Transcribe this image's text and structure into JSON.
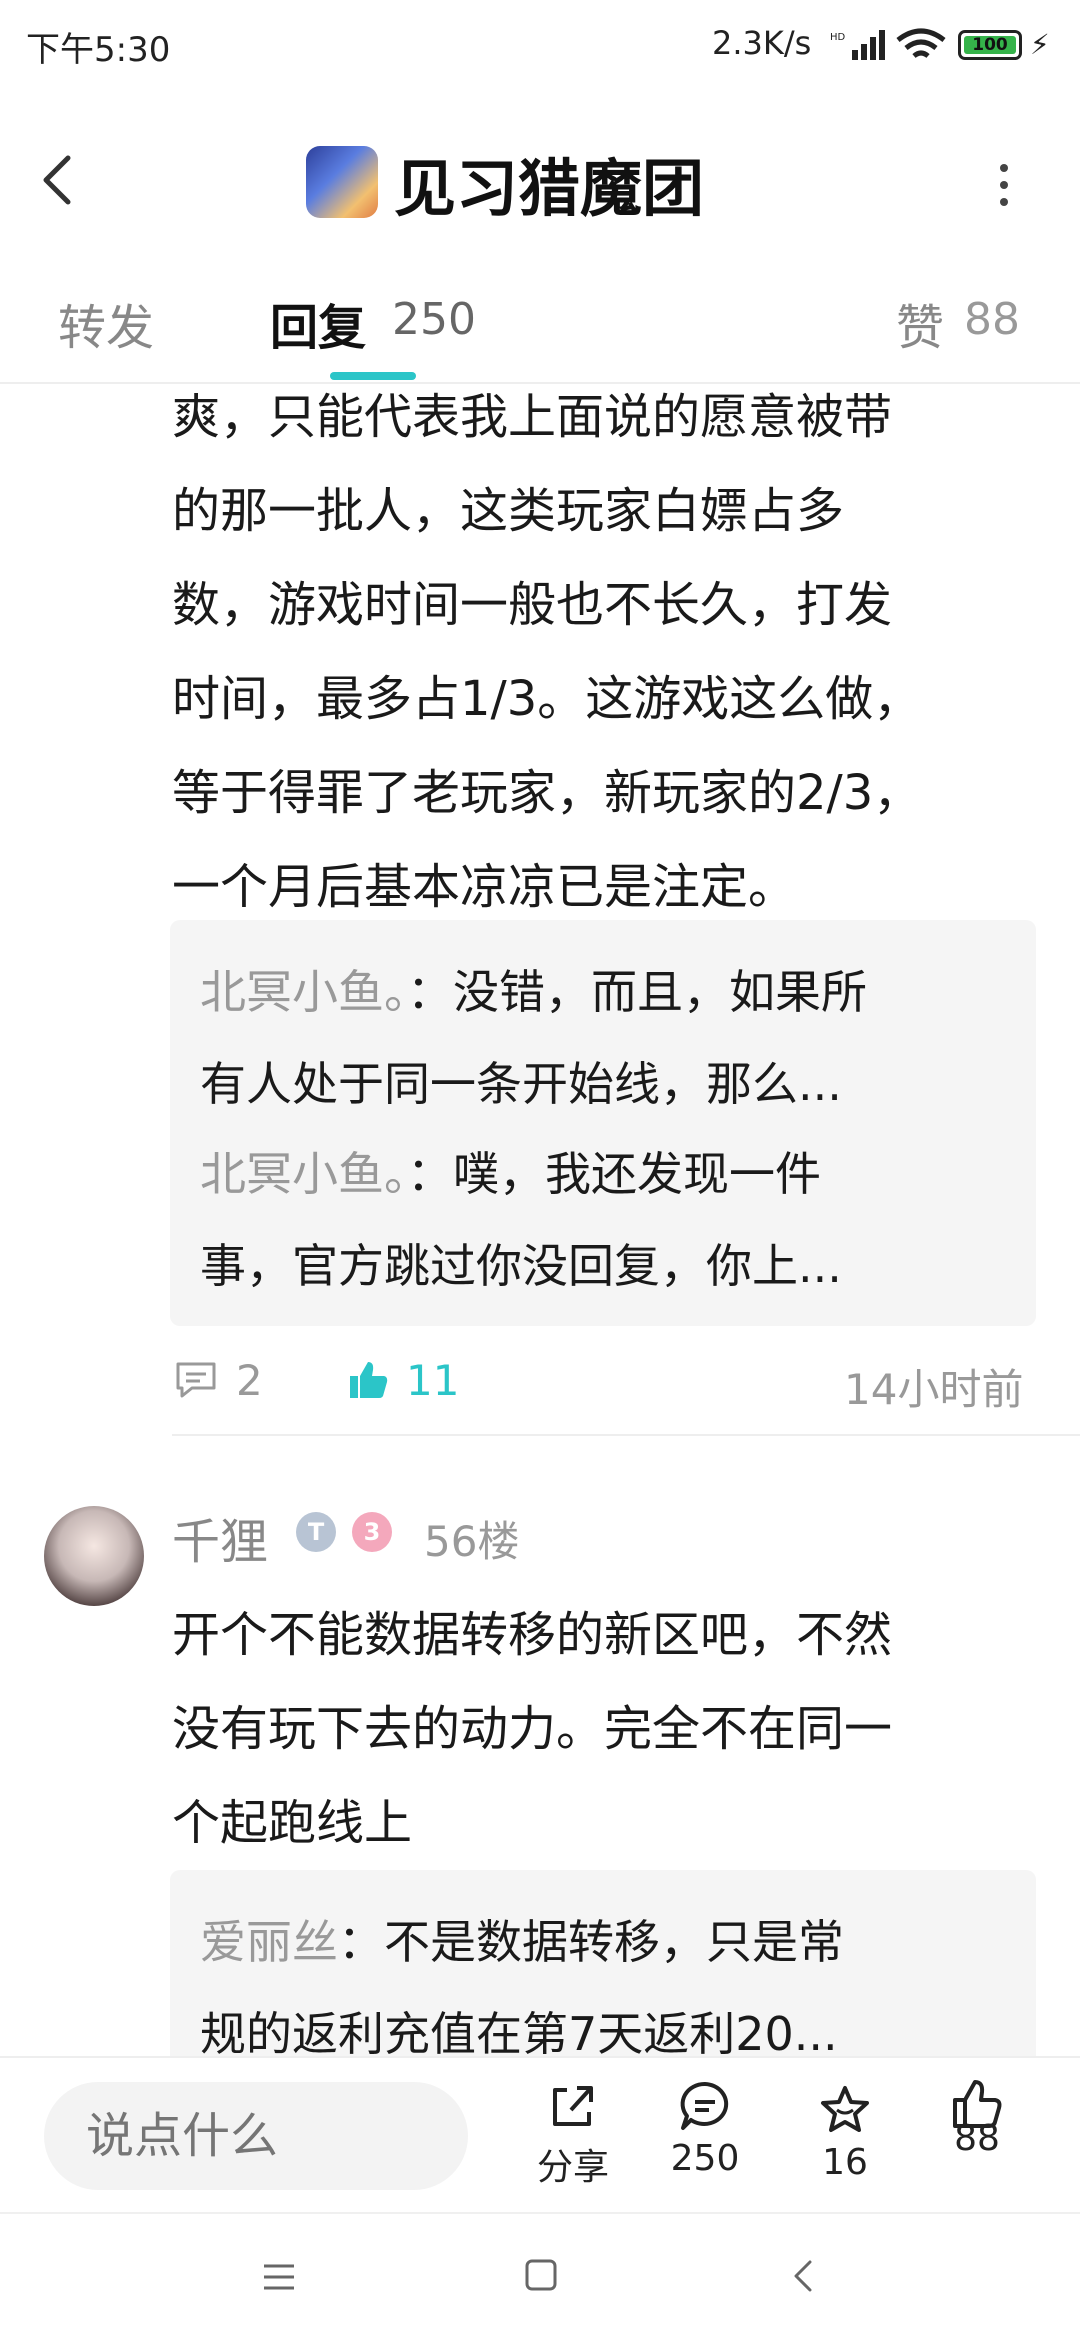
{
  "status_bar": {
    "time": "下午5:30",
    "network_speed": "2.3K/s",
    "battery": "100"
  },
  "header": {
    "title": "见习猎魔团"
  },
  "tabs": {
    "forward": "转发",
    "reply": "回复",
    "reply_count": "250",
    "like": "赞",
    "like_count": "88"
  },
  "post1": {
    "text_lines": [
      "爽，只能代表我上面说的愿意被带",
      "的那一批人，这类玩家白嫖占多",
      "数，游戏时间一般也不长久，打发",
      "时间，最多占1/3。这游戏这么做，",
      "等于得罪了老玩家，新玩家的2/3，",
      "一个月后基本凉凉已是注定。"
    ],
    "sub_replies": [
      {
        "name": "北冥小鱼。",
        "line1": "：没错，而且，如果所",
        "line2": "有人处于同一条开始线，那么..."
      },
      {
        "name": "北冥小鱼。",
        "line1": "：噗，我还发现一件",
        "line2": "事，官方跳过你没回复，你上..."
      }
    ],
    "comments": "2",
    "likes": "11",
    "time": "14小时前"
  },
  "post2": {
    "username": "千狸",
    "badge_t": "T",
    "badge_level": "3",
    "floor": "56楼",
    "text_lines": [
      "开个不能数据转移的新区吧，不然",
      "没有玩下去的动力。完全不在同一",
      "个起跑线上"
    ],
    "sub_replies": [
      {
        "name": "爱丽丝",
        "line1": "：不是数据转移，只是常",
        "line2": "规的返利充值在第7天返利20..."
      }
    ]
  },
  "bottom_bar": {
    "input_placeholder": "说点什么",
    "share": "分享",
    "comments": "250",
    "favorites": "16",
    "likes": "88"
  },
  "colors": {
    "accent": "#2bc5c8",
    "muted": "#999999"
  }
}
